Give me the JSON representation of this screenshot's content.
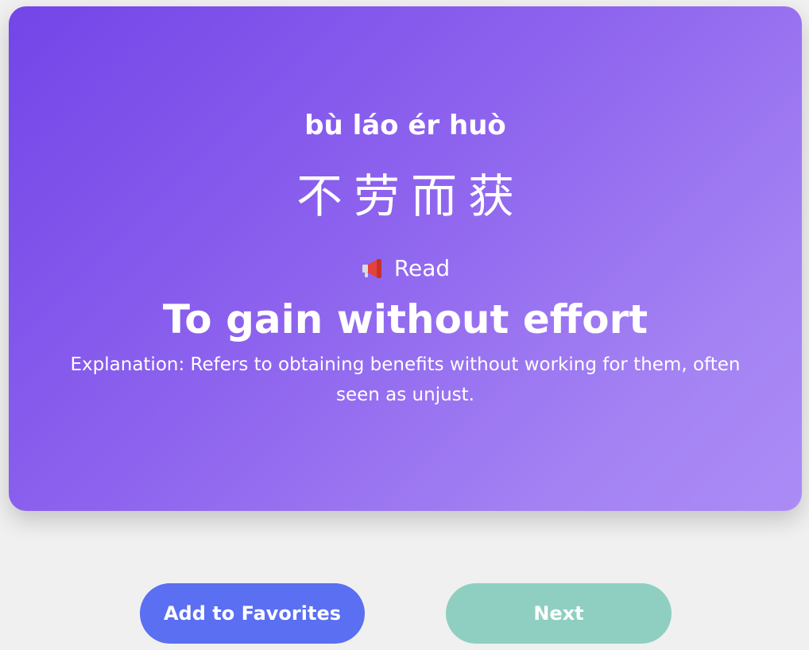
{
  "card": {
    "pinyin": "bù láo ér huò",
    "characters": "不劳而获",
    "read_label": "Read",
    "read_icon": "megaphone-icon",
    "meaning": "To gain without effort",
    "explanation": "Explanation: Refers to obtaining benefits without working for them, often seen as unjust."
  },
  "actions": {
    "favorite_label": "Add to Favorites",
    "next_label": "Next"
  },
  "colors": {
    "card_gradient_start": "#7445e8",
    "card_gradient_end": "#ab8cf6",
    "favorite_button": "#5b6ff2",
    "next_button": "#8fcfc1",
    "background": "#f0f0f0"
  }
}
